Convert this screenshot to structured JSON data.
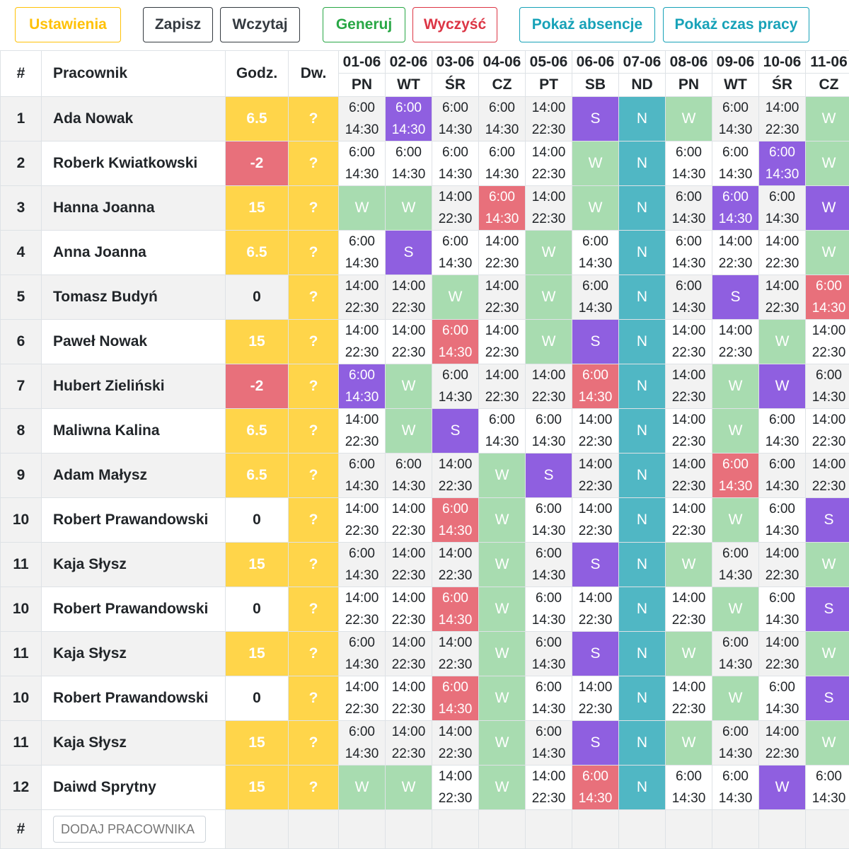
{
  "toolbar": {
    "settings": "Ustawienia",
    "save": "Zapisz",
    "load": "Wczytaj",
    "generate": "Generuj",
    "clear": "Wyczyść",
    "show_absence": "Pokaż absencje",
    "show_worktime": "Pokaż czas pracy"
  },
  "header": {
    "index": "#",
    "employee": "Pracownik",
    "hours": "Godz.",
    "dw": "Dw.",
    "dates": [
      "01-06",
      "02-06",
      "03-06",
      "04-06",
      "05-06",
      "06-06",
      "07-06",
      "08-06",
      "09-06",
      "10-06",
      "11-06"
    ],
    "days": [
      "PN",
      "WT",
      "ŚR",
      "CZ",
      "PT",
      "SB",
      "ND",
      "PN",
      "WT",
      "ŚR",
      "CZ"
    ]
  },
  "colors": {
    "yellow": "#ffd54a",
    "red": "#e8707b",
    "green_w": "#a8dcb0",
    "teal_n": "#50b7c4",
    "purple_s": "#8f5fe0"
  },
  "rows": [
    {
      "num": "1",
      "name": "Ada Nowak",
      "hours": "6.5",
      "hours_color": "yellow",
      "dw": "?",
      "cells": [
        "6:00|14:30",
        "P6:00|14:30",
        "6:00|14:30",
        "6:00|14:30",
        "14:00|22:30",
        "S",
        "N",
        "W",
        "6:00|14:30",
        "14:00|22:30",
        "W"
      ]
    },
    {
      "num": "2",
      "name": "Roberk Kwiatkowski",
      "hours": "-2",
      "hours_color": "red",
      "dw": "?",
      "cells": [
        "6:00|14:30",
        "6:00|14:30",
        "6:00|14:30",
        "6:00|14:30",
        "14:00|22:30",
        "W",
        "N",
        "6:00|14:30",
        "6:00|14:30",
        "P6:00|14:30",
        "W"
      ]
    },
    {
      "num": "3",
      "name": "Hanna Joanna",
      "hours": "15",
      "hours_color": "yellow",
      "dw": "?",
      "cells": [
        "W",
        "W",
        "14:00|22:30",
        "R6:00|14:30",
        "14:00|22:30",
        "W",
        "N",
        "6:00|14:30",
        "P6:00|14:30",
        "6:00|14:30",
        "WP"
      ]
    },
    {
      "num": "4",
      "name": "Anna Joanna",
      "hours": "6.5",
      "hours_color": "yellow",
      "dw": "?",
      "cells": [
        "6:00|14:30",
        "S",
        "6:00|14:30",
        "14:00|22:30",
        "W",
        "6:00|14:30",
        "N",
        "6:00|14:30",
        "14:00|22:30",
        "14:00|22:30",
        "W"
      ]
    },
    {
      "num": "5",
      "name": "Tomasz Budyń",
      "hours": "0",
      "hours_color": "gray",
      "dw": "?",
      "cells": [
        "14:00|22:30",
        "14:00|22:30",
        "W",
        "14:00|22:30",
        "W",
        "6:00|14:30",
        "N",
        "6:00|14:30",
        "S",
        "14:00|22:30",
        "R6:00|14:30"
      ]
    },
    {
      "num": "6",
      "name": "Paweł Nowak",
      "hours": "15",
      "hours_color": "yellow",
      "dw": "?",
      "cells": [
        "14:00|22:30",
        "14:00|22:30",
        "R6:00|14:30",
        "14:00|22:30",
        "W",
        "S",
        "N",
        "14:00|22:30",
        "14:00|22:30",
        "W",
        "14:00|22:30"
      ]
    },
    {
      "num": "7",
      "name": "Hubert Zieliński",
      "hours": "-2",
      "hours_color": "red",
      "dw": "?",
      "cells": [
        "P6:00|14:30",
        "W",
        "6:00|14:30",
        "14:00|22:30",
        "14:00|22:30",
        "R6:00|14:30",
        "N",
        "14:00|22:30",
        "W",
        "WP",
        "6:00|14:30"
      ]
    },
    {
      "num": "8",
      "name": "Maliwna Kalina",
      "hours": "6.5",
      "hours_color": "yellow",
      "dw": "?",
      "cells": [
        "14:00|22:30",
        "W",
        "S",
        "6:00|14:30",
        "6:00|14:30",
        "14:00|22:30",
        "N",
        "14:00|22:30",
        "W",
        "6:00|14:30",
        "14:00|22:30"
      ]
    },
    {
      "num": "9",
      "name": "Adam Małysz",
      "hours": "6.5",
      "hours_color": "yellow",
      "dw": "?",
      "cells": [
        "6:00|14:30",
        "6:00|14:30",
        "14:00|22:30",
        "W",
        "S",
        "14:00|22:30",
        "N",
        "14:00|22:30",
        "R6:00|14:30",
        "6:00|14:30",
        "14:00|22:30"
      ]
    },
    {
      "num": "10",
      "name": "Robert Prawandowski",
      "hours": "0",
      "hours_color": "white",
      "dw": "?",
      "cells": [
        "14:00|22:30",
        "14:00|22:30",
        "R6:00|14:30",
        "W",
        "6:00|14:30",
        "14:00|22:30",
        "N",
        "14:00|22:30",
        "W",
        "6:00|14:30",
        "S"
      ]
    },
    {
      "num": "11",
      "name": "Kaja Słysz",
      "hours": "15",
      "hours_color": "yellow",
      "dw": "?",
      "cells": [
        "6:00|14:30",
        "14:00|22:30",
        "14:00|22:30",
        "W",
        "6:00|14:30",
        "S",
        "N",
        "W",
        "6:00|14:30",
        "14:00|22:30",
        "W"
      ]
    },
    {
      "num": "10",
      "name": "Robert Prawandowski",
      "hours": "0",
      "hours_color": "white",
      "dw": "?",
      "cells": [
        "14:00|22:30",
        "14:00|22:30",
        "R6:00|14:30",
        "W",
        "6:00|14:30",
        "14:00|22:30",
        "N",
        "14:00|22:30",
        "W",
        "6:00|14:30",
        "S"
      ]
    },
    {
      "num": "11",
      "name": "Kaja Słysz",
      "hours": "15",
      "hours_color": "yellow",
      "dw": "?",
      "cells": [
        "6:00|14:30",
        "14:00|22:30",
        "14:00|22:30",
        "W",
        "6:00|14:30",
        "S",
        "N",
        "W",
        "6:00|14:30",
        "14:00|22:30",
        "W"
      ]
    },
    {
      "num": "10",
      "name": "Robert Prawandowski",
      "hours": "0",
      "hours_color": "white",
      "dw": "?",
      "cells": [
        "14:00|22:30",
        "14:00|22:30",
        "R6:00|14:30",
        "W",
        "6:00|14:30",
        "14:00|22:30",
        "N",
        "14:00|22:30",
        "W",
        "6:00|14:30",
        "S"
      ]
    },
    {
      "num": "11",
      "name": "Kaja Słysz",
      "hours": "15",
      "hours_color": "yellow",
      "dw": "?",
      "cells": [
        "6:00|14:30",
        "14:00|22:30",
        "14:00|22:30",
        "W",
        "6:00|14:30",
        "S",
        "N",
        "W",
        "6:00|14:30",
        "14:00|22:30",
        "W"
      ]
    },
    {
      "num": "12",
      "name": "Daiwd Sprytny",
      "hours": "15",
      "hours_color": "yellow",
      "dw": "?",
      "cells": [
        "W",
        "W",
        "14:00|22:30",
        "W",
        "14:00|22:30",
        "R6:00|14:30",
        "N",
        "6:00|14:30",
        "6:00|14:30",
        "WP",
        "6:00|14:30"
      ]
    }
  ],
  "footer": {
    "index": "#",
    "add_placeholder": "DODAJ PRACOWNIKA"
  }
}
